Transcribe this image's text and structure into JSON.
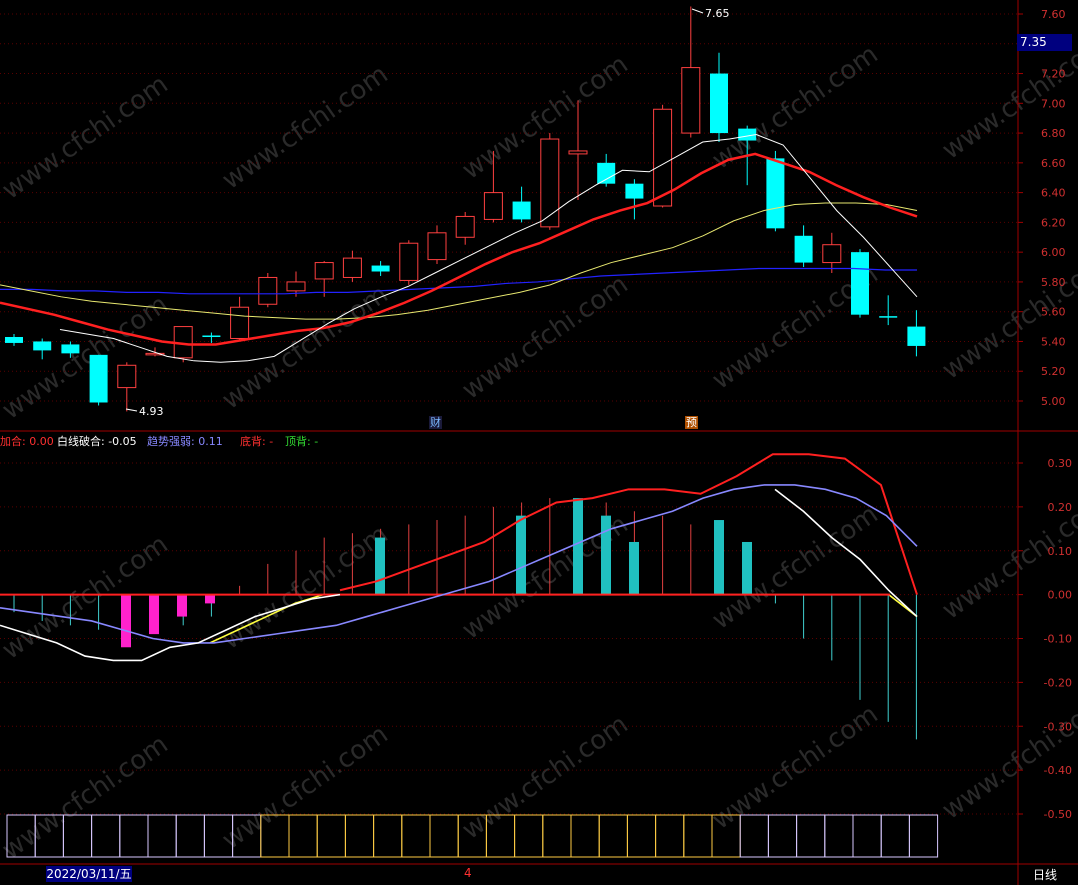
{
  "chart_data": [
    {
      "type": "candlestick",
      "panel": "price",
      "y_ticks": [
        "7.60",
        "7.40",
        "7.20",
        "7.00",
        "6.80",
        "6.60",
        "6.40",
        "6.20",
        "6.00",
        "5.80",
        "5.60",
        "5.40",
        "5.20",
        "5.00"
      ],
      "ylim": [
        4.85,
        7.65
      ],
      "current_price": "7.35",
      "high_annotation": "7.65",
      "low_annotation": "4.93",
      "candles": [
        {
          "o": 5.43,
          "c": 5.39,
          "h": 5.45,
          "l": 5.37
        },
        {
          "o": 5.4,
          "c": 5.34,
          "h": 5.42,
          "l": 5.28
        },
        {
          "o": 5.38,
          "c": 5.32,
          "h": 5.4,
          "l": 5.29
        },
        {
          "o": 5.31,
          "c": 4.99,
          "h": 5.31,
          "l": 4.97
        },
        {
          "o": 5.09,
          "c": 5.24,
          "h": 5.26,
          "l": 4.93
        },
        {
          "o": 5.31,
          "c": 5.32,
          "h": 5.36,
          "l": 5.3
        },
        {
          "o": 5.29,
          "c": 5.5,
          "h": 5.5,
          "l": 5.26
        },
        {
          "o": 5.44,
          "c": 5.43,
          "h": 5.46,
          "l": 5.39
        },
        {
          "o": 5.42,
          "c": 5.63,
          "h": 5.7,
          "l": 5.4
        },
        {
          "o": 5.65,
          "c": 5.83,
          "h": 5.86,
          "l": 5.63
        },
        {
          "o": 5.74,
          "c": 5.8,
          "h": 5.87,
          "l": 5.7
        },
        {
          "o": 5.82,
          "c": 5.93,
          "h": 5.94,
          "l": 5.7
        },
        {
          "o": 5.83,
          "c": 5.96,
          "h": 6.01,
          "l": 5.8
        },
        {
          "o": 5.91,
          "c": 5.87,
          "h": 5.94,
          "l": 5.84
        },
        {
          "o": 5.81,
          "c": 6.06,
          "h": 6.08,
          "l": 5.78
        },
        {
          "o": 5.95,
          "c": 6.13,
          "h": 6.18,
          "l": 5.92
        },
        {
          "o": 6.1,
          "c": 6.24,
          "h": 6.27,
          "l": 6.05
        },
        {
          "o": 6.22,
          "c": 6.4,
          "h": 6.68,
          "l": 6.2
        },
        {
          "o": 6.34,
          "c": 6.22,
          "h": 6.44,
          "l": 6.2
        },
        {
          "o": 6.17,
          "c": 6.76,
          "h": 6.8,
          "l": 6.15
        },
        {
          "o": 6.66,
          "c": 6.68,
          "h": 7.02,
          "l": 6.35
        },
        {
          "o": 6.6,
          "c": 6.46,
          "h": 6.66,
          "l": 6.44
        },
        {
          "o": 6.46,
          "c": 6.36,
          "h": 6.49,
          "l": 6.22
        },
        {
          "o": 6.31,
          "c": 6.96,
          "h": 6.99,
          "l": 6.3
        },
        {
          "o": 6.8,
          "c": 7.24,
          "h": 7.65,
          "l": 6.77
        },
        {
          "o": 7.2,
          "c": 6.8,
          "h": 7.34,
          "l": 6.74
        },
        {
          "o": 6.83,
          "c": 6.75,
          "h": 6.85,
          "l": 6.45
        },
        {
          "o": 6.63,
          "c": 6.16,
          "h": 6.68,
          "l": 6.14
        },
        {
          "o": 6.11,
          "c": 5.93,
          "h": 6.18,
          "l": 5.9
        },
        {
          "o": 5.93,
          "c": 6.05,
          "h": 6.13,
          "l": 5.86
        },
        {
          "o": 6.0,
          "c": 5.58,
          "h": 6.02,
          "l": 5.56
        },
        {
          "o": 5.57,
          "c": 5.56,
          "h": 5.71,
          "l": 5.51
        },
        {
          "o": 5.5,
          "c": 5.37,
          "h": 5.61,
          "l": 5.3
        }
      ],
      "lines": [
        {
          "color": "#ffffff",
          "values": [
            5.48,
            5.45,
            5.42,
            5.36,
            5.3,
            5.27,
            5.26,
            5.27,
            5.3,
            5.41,
            5.52,
            5.62,
            5.7,
            5.77,
            5.86,
            5.95,
            6.04,
            6.13,
            6.21,
            6.34,
            6.45,
            6.55,
            6.54,
            6.64,
            6.74,
            6.76,
            6.79,
            6.72,
            6.5,
            6.28,
            6.1,
            5.9,
            5.7
          ]
        },
        {
          "color": "#ff2020",
          "values": [
            5.66,
            5.62,
            5.58,
            5.53,
            5.48,
            5.44,
            5.4,
            5.38,
            5.38,
            5.41,
            5.44,
            5.47,
            5.49,
            5.53,
            5.59,
            5.66,
            5.74,
            5.83,
            5.92,
            6.0,
            6.06,
            6.14,
            6.22,
            6.28,
            6.33,
            6.42,
            6.53,
            6.62,
            6.66,
            6.6,
            6.54,
            6.45,
            6.37,
            6.3,
            6.24
          ]
        },
        {
          "color": "#e8e870",
          "values": [
            5.78,
            5.74,
            5.7,
            5.67,
            5.65,
            5.63,
            5.61,
            5.59,
            5.57,
            5.56,
            5.55,
            5.55,
            5.56,
            5.58,
            5.61,
            5.65,
            5.69,
            5.73,
            5.78,
            5.86,
            5.93,
            5.98,
            6.03,
            6.11,
            6.21,
            6.28,
            6.32,
            6.33,
            6.33,
            6.32,
            6.28
          ]
        },
        {
          "color": "#2222ff",
          "values": [
            5.75,
            5.75,
            5.74,
            5.74,
            5.73,
            5.73,
            5.72,
            5.72,
            5.72,
            5.72,
            5.73,
            5.73,
            5.74,
            5.75,
            5.76,
            5.77,
            5.79,
            5.8,
            5.82,
            5.84,
            5.85,
            5.86,
            5.87,
            5.88,
            5.89,
            5.89,
            5.89,
            5.89,
            5.88,
            5.88
          ]
        }
      ],
      "markers": [
        {
          "text": "财",
          "color": "#7ab8ff",
          "bg": "#1a1a3a"
        },
        {
          "text": "预",
          "color": "#ffffff",
          "bg": "#b05000"
        }
      ]
    },
    {
      "type": "bar+line",
      "panel": "indicator",
      "y_ticks": [
        "0.30",
        "0.20",
        "0.10",
        "0.00",
        "-0.10",
        "-0.20",
        "-0.30",
        "-0.40",
        "-0.50"
      ],
      "ylim": [
        -0.52,
        0.34
      ],
      "legend": [
        {
          "label": "加合: 0.00",
          "color": "#ff3030"
        },
        {
          "label": "白线破合: -0.05",
          "color": "#ffffff"
        },
        {
          "label": "趋势强弱: 0.11",
          "color": "#8888ff"
        },
        {
          "label": "底背: -",
          "color": "#ff3030"
        },
        {
          "label": "顶背: -",
          "color": "#33dd33"
        }
      ],
      "thin_bars": [
        -0.04,
        -0.06,
        -0.07,
        -0.08,
        -0.09,
        -0.08,
        -0.07,
        -0.05,
        0.02,
        0.07,
        0.1,
        0.13,
        0.14,
        0.15,
        0.16,
        0.17,
        0.18,
        0.2,
        0.21,
        0.22,
        0.22,
        0.21,
        0.19,
        0.18,
        0.16,
        0.14,
        0.05,
        -0.02,
        -0.1,
        -0.15,
        -0.24,
        -0.29,
        -0.33
      ],
      "mag_bars": [
        -0.12,
        -0.09,
        -0.05,
        -0.02
      ],
      "cyan_bars": [
        0.13,
        0.18,
        0.22,
        0.18,
        0.12,
        0.17,
        0.12
      ],
      "lines": [
        {
          "color": "#ffffff",
          "values": [
            -0.07,
            -0.09,
            -0.11,
            -0.14,
            -0.15,
            -0.15,
            -0.12,
            -0.11,
            -0.08,
            -0.05,
            -0.03,
            -0.01,
            0.0,
            0.0,
            0.0,
            0.0,
            0.0,
            0.0,
            0.0,
            0.0,
            0.0,
            0.0,
            0.0,
            0.0,
            0.0,
            0.0,
            0.0,
            0.0,
            0.24,
            0.19,
            0.13,
            0.08,
            0.01,
            -0.05
          ]
        },
        {
          "color": "#8888ff",
          "values": [
            -0.03,
            -0.04,
            -0.05,
            -0.06,
            -0.08,
            -0.1,
            -0.11,
            -0.11,
            -0.1,
            -0.09,
            -0.08,
            -0.07,
            -0.05,
            -0.03,
            -0.01,
            0.01,
            0.03,
            0.06,
            0.09,
            0.12,
            0.15,
            0.17,
            0.19,
            0.22,
            0.24,
            0.25,
            0.25,
            0.24,
            0.22,
            0.18,
            0.11
          ]
        },
        {
          "color": "#ff2020",
          "values": [
            0.01,
            0.03,
            0.06,
            0.09,
            0.12,
            0.17,
            0.21,
            0.22,
            0.24,
            0.24,
            0.23,
            0.27,
            0.32,
            0.32,
            0.31,
            0.25,
            0.0
          ]
        },
        {
          "color": "#ffff40",
          "values": [
            -0.11,
            -0.08,
            -0.05,
            -0.02,
            0.0,
            0.0,
            0.0,
            0.0,
            0.0,
            0.0,
            0.0,
            0.0,
            0.0,
            0.0,
            0.0,
            0.0,
            0.0,
            0.0,
            0.0,
            0.0,
            0.0,
            0.0,
            0.0,
            0.0,
            0.0,
            -0.05
          ]
        }
      ]
    },
    {
      "type": "strip",
      "panel": "bottom",
      "colors": [
        "#d8c8ff",
        "#d8c8ff",
        "#d8c8ff",
        "#d8c8ff",
        "#d8c8ff",
        "#d8c8ff",
        "#d8c8ff",
        "#d8c8ff",
        "#d8c8ff",
        "#ffcc44",
        "#ffcc44",
        "#ffcc44",
        "#ffcc44",
        "#ffcc44",
        "#ffcc44",
        "#ffcc44",
        "#ffcc44",
        "#ffcc44",
        "#ffcc44",
        "#ffcc44",
        "#ffcc44",
        "#ffcc44",
        "#ffcc44",
        "#ffcc44",
        "#ffcc44",
        "#ffcc44",
        "#d8c8ff",
        "#d8c8ff",
        "#d8c8ff",
        "#d8c8ff",
        "#d8c8ff",
        "#d8c8ff",
        "#d8c8ff"
      ]
    }
  ],
  "footer": {
    "date": "2022/03/11/五",
    "cursor": "4",
    "period": "日线"
  },
  "watermark": "www.cfchi.com"
}
